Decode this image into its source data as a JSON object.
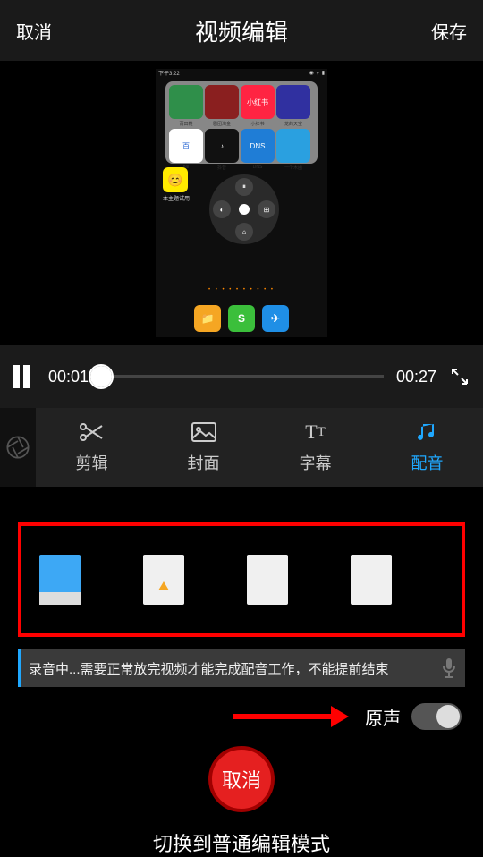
{
  "header": {
    "cancel": "取消",
    "title": "视频编辑",
    "save": "保存"
  },
  "preview": {
    "status_time": "下午3:22",
    "side_app_label": "本主题试用",
    "side_app_icon": "😊",
    "folder_apps": [
      {
        "label": "莆田鞋",
        "bg": "#2f8f4a"
      },
      {
        "label": "剧团淘金",
        "bg": "#8a1f1f"
      },
      {
        "label": "小红书",
        "bg": "#ff2442",
        "text": "小红书"
      },
      {
        "label": "龙的天空",
        "bg": "#3030a0"
      },
      {
        "label": "bai",
        "bg": "#ffffff",
        "text": "百"
      },
      {
        "label": "抖音",
        "bg": "#111111",
        "text": "♪"
      },
      {
        "label": "DNS",
        "bg": "#1f7dd6",
        "text": "DNS"
      },
      {
        "label": "一个木函",
        "bg": "#2aa0e0"
      }
    ],
    "radial_labels": [
      "暂停",
      "海柠",
      "主屏幕",
      "切换窗口"
    ],
    "dock": [
      {
        "bg": "#f5a623",
        "glyph": "📁"
      },
      {
        "bg": "#3bbf3b",
        "glyph": "S"
      },
      {
        "bg": "#1f8fe6",
        "glyph": "✈"
      }
    ]
  },
  "playback": {
    "current": "00:01",
    "duration": "00:27"
  },
  "tabs": {
    "cut": "剪辑",
    "cover": "封面",
    "subtitle": "字幕",
    "dub": "配音"
  },
  "recording": {
    "text": "录音中...需要正常放完视频才能完成配音工作，不能提前结束"
  },
  "sound": {
    "label": "原声"
  },
  "cancel_button": "取消",
  "footer": "切换到普通编辑模式"
}
